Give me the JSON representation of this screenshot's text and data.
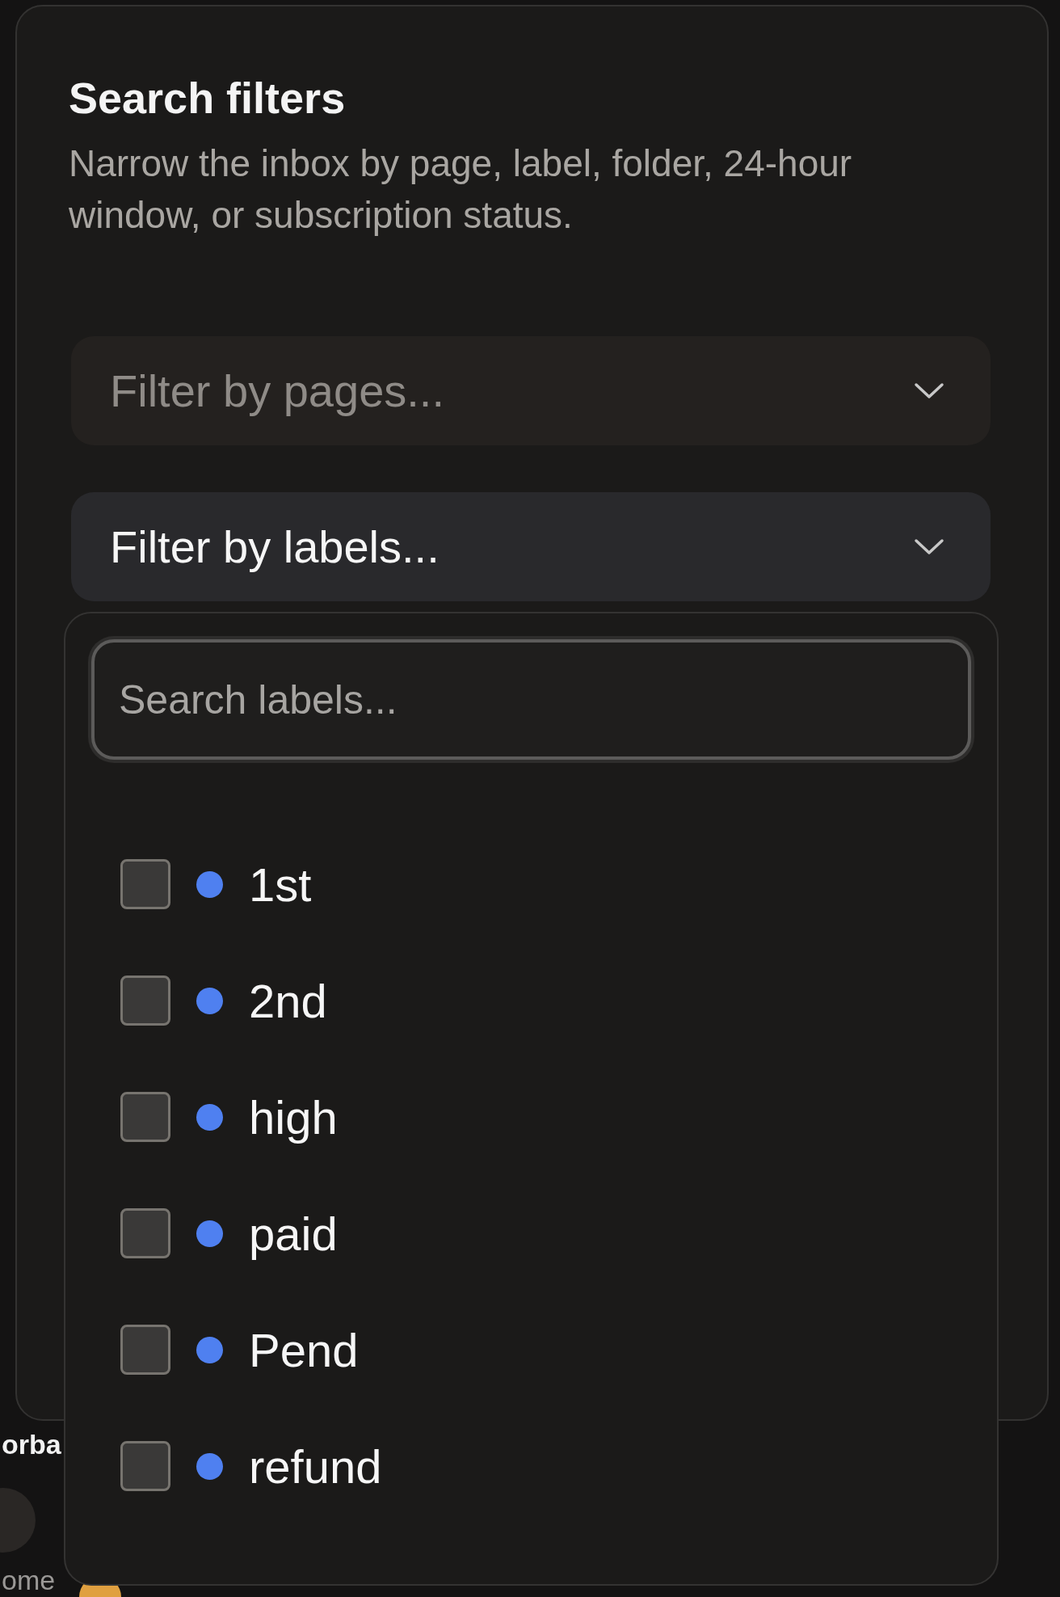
{
  "background": {
    "heading": "orba",
    "snippet": "ome"
  },
  "dialog": {
    "title": "Search filters",
    "description": "Narrow the inbox by page, label, folder, 24-hour window, or subscription status.",
    "selects": [
      {
        "placeholder": "Filter by pages...",
        "open": false
      },
      {
        "placeholder": "Filter by labels...",
        "open": true
      }
    ]
  },
  "label_menu": {
    "search": {
      "placeholder": "Search labels..."
    },
    "items": [
      {
        "label": "1st",
        "checked": false,
        "color": "#4f80f0"
      },
      {
        "label": "2nd",
        "checked": false,
        "color": "#4f80f0"
      },
      {
        "label": "high",
        "checked": false,
        "color": "#4f80f0"
      },
      {
        "label": "paid",
        "checked": false,
        "color": "#4f80f0"
      },
      {
        "label": "Pend",
        "checked": false,
        "color": "#4f80f0"
      },
      {
        "label": "refund",
        "checked": false,
        "color": "#4f80f0"
      }
    ]
  }
}
